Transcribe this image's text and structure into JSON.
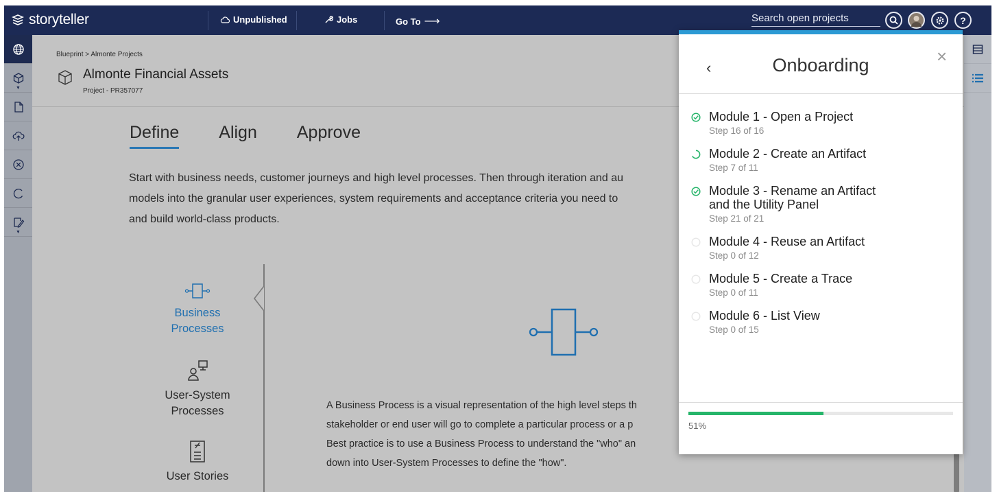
{
  "app": {
    "logo_text": "storyteller",
    "nav": {
      "unpublished_label": "Unpublished",
      "jobs_label": "Jobs",
      "goto_label": "Go To",
      "goto_arrow": "⟶"
    },
    "search": {
      "placeholder": "Search open projects"
    }
  },
  "page": {
    "breadcrumb": "Blueprint > Almonte Projects",
    "title": "Almonte Financial Assets",
    "subtitle": "Project - PR357077",
    "tabs": [
      {
        "label": "Define",
        "active": true
      },
      {
        "label": "Align",
        "active": false
      },
      {
        "label": "Approve",
        "active": false
      }
    ],
    "intro": "Start with business needs, customer journeys and high level processes. Then through iteration and au models into the granular user experiences, system requirements and acceptance criteria you need to and build world-class products.",
    "intro_lines": [
      "Start with business needs, customer journeys and high level processes. Then through iteration and au",
      "models into the granular user experiences, system requirements and acceptance criteria you need to",
      "and build world-class products."
    ],
    "left_nav": [
      {
        "label_line1": "Business",
        "label_line2": "Processes",
        "icon": "business-process-icon",
        "active": true
      },
      {
        "label_line1": "User-System",
        "label_line2": "Processes",
        "icon": "user-system-process-icon",
        "active": false
      },
      {
        "label_line1": "User Stories",
        "label_line2": "",
        "icon": "user-story-icon",
        "active": false
      }
    ],
    "description_lines": [
      "A Business Process is a visual representation of the high level steps th",
      "stakeholder or end user will go to complete a particular process or a p",
      "Best practice is to use a Business Process to understand the \"who\" an",
      "down into User-System Processes to define the \"how\"."
    ]
  },
  "onboarding": {
    "title": "Onboarding",
    "back_glyph": "‹",
    "close_glyph": "×",
    "modules": [
      {
        "title_line1": "Module 1 - Open a Project",
        "title_line2": "",
        "step": "Step 16 of 16",
        "status": "complete"
      },
      {
        "title_line1": "Module 2 - Create an Artifact",
        "title_line2": "",
        "step": "Step 7 of 11",
        "status": "in-progress"
      },
      {
        "title_line1": "Module 3 - Rename an Artifact",
        "title_line2": "and the Utility Panel",
        "step": "Step 21 of 21",
        "status": "complete"
      },
      {
        "title_line1": "Module 4 - Reuse an Artifact",
        "title_line2": "",
        "step": "Step 0 of 12",
        "status": "not-started"
      },
      {
        "title_line1": "Module 5 - Create a Trace",
        "title_line2": "",
        "step": "Step 0 of 11",
        "status": "not-started"
      },
      {
        "title_line1": "Module 6 - List View",
        "title_line2": "",
        "step": "Step 0 of 15",
        "status": "not-started"
      }
    ],
    "progress": 0.51,
    "progress_label": "51%"
  },
  "colors": {
    "topbar": "#1c2a55",
    "accent_blue": "#1f6fb0",
    "panel_top": "#2c9ad4",
    "complete_green": "#26b56a"
  },
  "icons": {
    "left_rail": [
      "globe-icon",
      "cube-icon",
      "document-icon",
      "cloud-upload-icon",
      "close-circle-icon",
      "refresh-icon",
      "edit-note-icon"
    ],
    "right_rail": [
      "table-icon",
      "list-icon"
    ],
    "topbar_buttons": [
      "search-icon",
      "avatar",
      "gear-icon",
      "help-icon"
    ]
  }
}
